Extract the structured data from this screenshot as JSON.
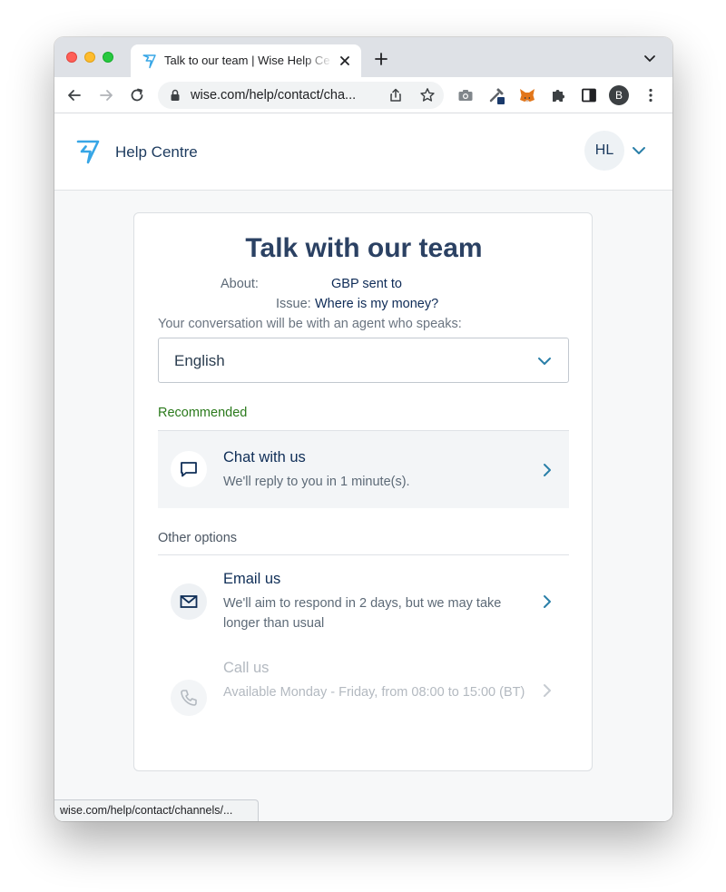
{
  "browser": {
    "tab_title": "Talk to our team | Wise Help Ce",
    "url": "wise.com/help/contact/cha...",
    "profile_initial": "B",
    "status_url": "wise.com/help/contact/channels/..."
  },
  "header": {
    "title": "Help Centre",
    "user_initials": "HL"
  },
  "card": {
    "title": "Talk with our team",
    "about_label": "About:",
    "about_value": "GBP sent to",
    "issue_label": "Issue:",
    "issue_value": "Where is my money?",
    "language_hint": "Your conversation will be with an agent who speaks:",
    "language_selected": "English",
    "recommended_label": "Recommended",
    "other_options_label": "Other options",
    "options": [
      {
        "title": "Chat with us",
        "description": "We'll reply to you in 1 minute(s).",
        "enabled": true
      },
      {
        "title": "Email us",
        "description": "We'll aim to respond in 2 days, but we may take longer than usual",
        "enabled": true
      },
      {
        "title": "Call us",
        "description": "Available Monday - Friday, from 08:00 to 15:00 (BT)",
        "enabled": false
      }
    ]
  },
  "colors": {
    "brand_blue": "#2b4163",
    "wise_logo": "#37a6e6",
    "recommended_green": "#2b7a1c",
    "accent_teal": "#2a7fa8"
  }
}
